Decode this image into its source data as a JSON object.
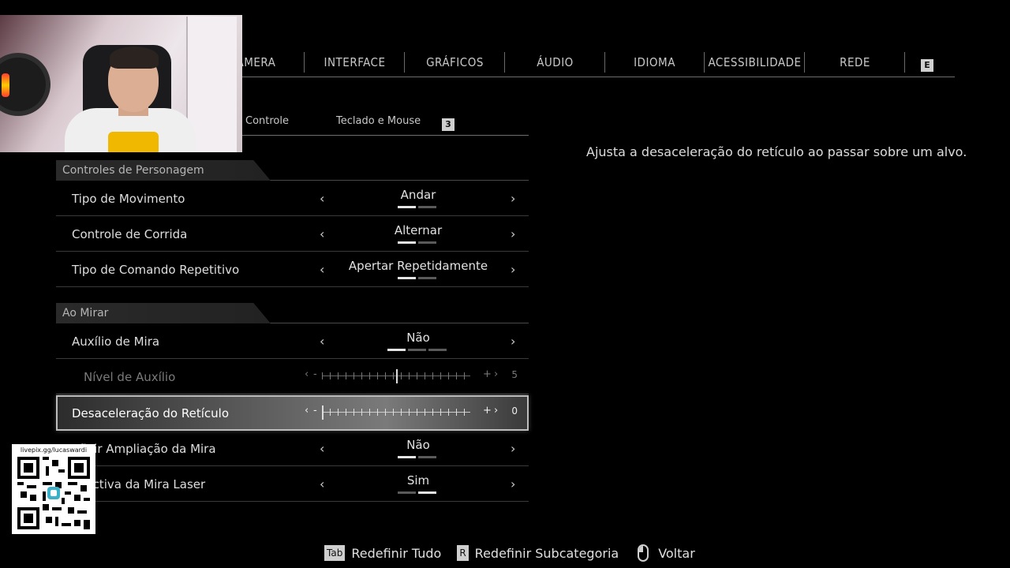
{
  "top_tabs": [
    {
      "label": "CÂMERA"
    },
    {
      "label": "INTERFACE"
    },
    {
      "label": "GRÁFICOS"
    },
    {
      "label": "ÁUDIO"
    },
    {
      "label": "IDIOMA"
    },
    {
      "label": "ACESSIBILIDADE"
    },
    {
      "label": "REDE"
    }
  ],
  "top_tab_key": "E",
  "sub_tabs": [
    {
      "label": "Controle"
    },
    {
      "label": "Teclado e Mouse"
    }
  ],
  "sub_tab_key": "3",
  "sections": [
    {
      "title": "Controles de Personagem"
    },
    {
      "title": "Ao Mirar"
    }
  ],
  "rows": [
    {
      "label": "Tipo de Movimento",
      "value": "Andar",
      "pips": 2,
      "active_pip": 0
    },
    {
      "label": "Controle de Corrida",
      "value": "Alternar",
      "pips": 2,
      "active_pip": 0
    },
    {
      "label": "Tipo de Comando Repetitivo",
      "value": "Apertar Repetidamente",
      "pips": 2,
      "active_pip": 0
    },
    {
      "label": "Auxílio de Mira",
      "value": "Não",
      "pips": 3,
      "active_pip": 0
    },
    {
      "label": "Nível de Auxílio",
      "slider_value": "5",
      "slider_level": 0.5,
      "disabled": true
    },
    {
      "label": "Desaceleração do Retículo",
      "slider_value": "0",
      "slider_level": 0.0,
      "selected": true
    },
    {
      "label": "efinir Ampliação da Mira",
      "value": "Não",
      "pips": 2,
      "active_pip": 0
    },
    {
      "label": "spectiva da Mira Laser",
      "value": "Sim",
      "pips": 2,
      "active_pip": 1
    }
  ],
  "slider_symbols": {
    "left": "‹",
    "minus": "-",
    "plus": "+",
    "right": "›"
  },
  "arrows": {
    "left": "‹",
    "right": "›"
  },
  "description": "Ajusta a desaceleração do retículo ao passar sobre um alvo.",
  "qr": {
    "url": "livepix.gg/lucaswardi"
  },
  "hints": [
    {
      "key": "Tab",
      "label": "Redefinir Tudo"
    },
    {
      "key": "R",
      "label": "Redefinir Subcategoria"
    },
    {
      "icon": "mouse-icon",
      "label": "Voltar"
    }
  ]
}
